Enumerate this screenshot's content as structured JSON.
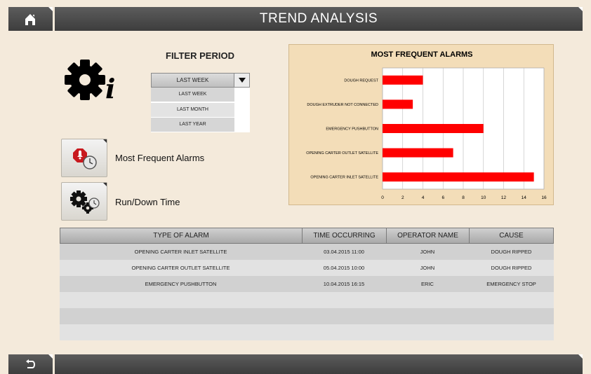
{
  "header": {
    "title": "TREND ANALYSIS",
    "home_icon": "home-icon"
  },
  "footer": {
    "back_icon": "back-icon"
  },
  "filter": {
    "title": "FILTER PERIOD",
    "selected": "LAST WEEK",
    "options": [
      "LAST WEEK",
      "LAST MONTH",
      "LAST YEAR"
    ]
  },
  "menu": {
    "alarms_label": "Most Frequent Alarms",
    "runtime_label": "Run/Down Time"
  },
  "chart_data": {
    "type": "bar",
    "orientation": "horizontal",
    "title": "MOST FREQUENT ALARMS",
    "categories": [
      "DOUGH REQUEST",
      "DOUGH EXTRUDER NOT CONNECTED",
      "EMERGENCY PUSHBUTTON",
      "OPENING CARTER OUTLET SATELLITE",
      "OPENING CARTER INLET SATELLITE"
    ],
    "values": [
      4,
      3,
      10,
      7,
      15
    ],
    "xlim": [
      0,
      16
    ],
    "xticks": [
      0,
      2,
      4,
      6,
      8,
      10,
      12,
      14,
      16
    ],
    "grid": true,
    "bar_color": "#ff0000"
  },
  "table": {
    "headers": [
      "TYPE OF ALARM",
      "TIME OCCURRING",
      "OPERATOR NAME",
      "CAUSE"
    ],
    "rows": [
      [
        "OPENING CARTER INLET SATELLITE",
        "03.04.2015 11:00",
        "JOHN",
        "DOUGH RIPPED"
      ],
      [
        "OPENING CARTER OUTLET SATELLITE",
        "05.04.2015 10:00",
        "JOHN",
        "DOUGH RIPPED"
      ],
      [
        "EMERGENCY PUSHBUTTON",
        "10.04.2015 16:15",
        "ERIC",
        "EMERGENCY STOP"
      ],
      [
        "",
        "",
        "",
        ""
      ],
      [
        "",
        "",
        "",
        ""
      ],
      [
        "",
        "",
        "",
        ""
      ]
    ]
  }
}
